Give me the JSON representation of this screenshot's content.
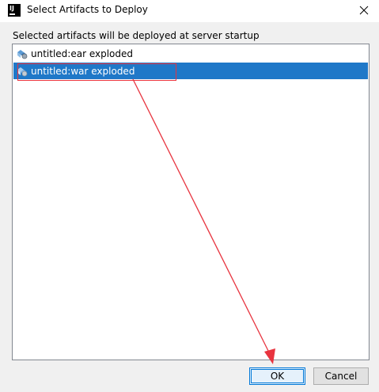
{
  "window": {
    "title": "Select Artifacts to Deploy",
    "icon_text": "IJ"
  },
  "description": "Selected artifacts will be deployed at server startup",
  "artifacts": [
    {
      "label": "untitled:ear exploded",
      "selected": false,
      "icon": "artifact-icon"
    },
    {
      "label": "untitled:war exploded",
      "selected": true,
      "icon": "artifact-icon"
    }
  ],
  "buttons": {
    "ok_label": "OK",
    "cancel_label": "Cancel"
  },
  "colors": {
    "selection": "#1f78c8",
    "annotation": "#e8343f"
  }
}
